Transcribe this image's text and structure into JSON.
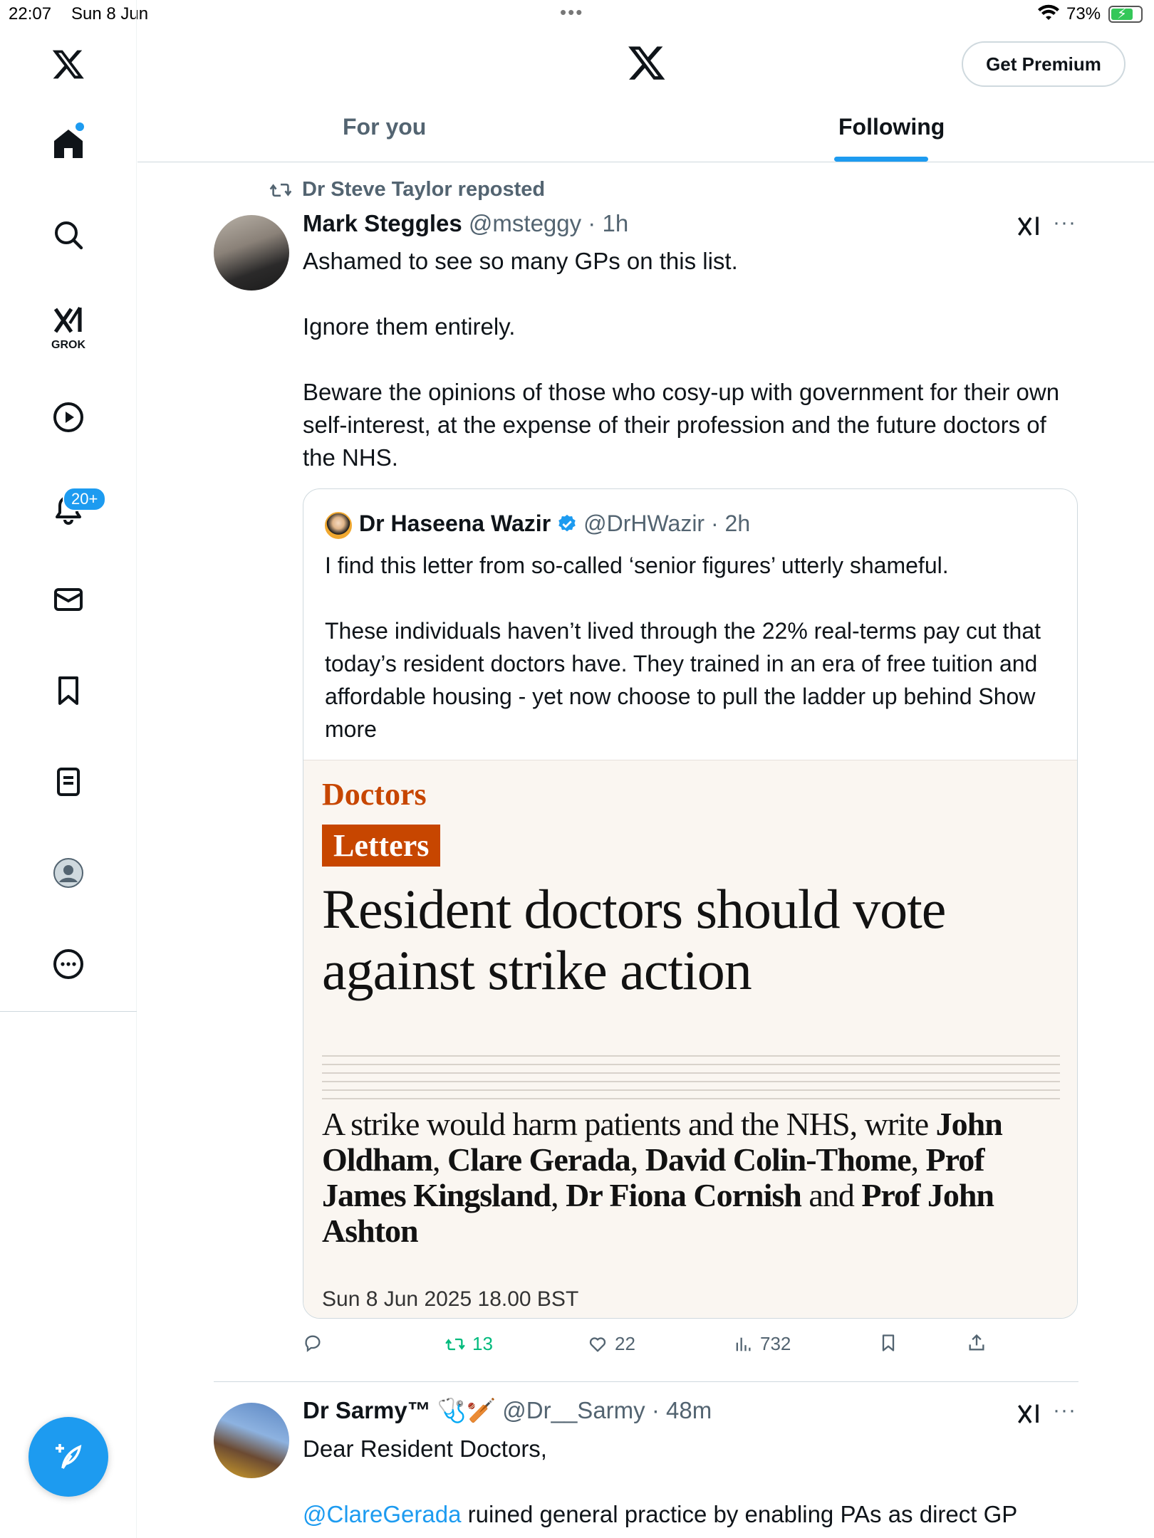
{
  "status_bar": {
    "time": "22:07",
    "date": "Sun 8 Jun",
    "battery": "73%"
  },
  "sidebar": {
    "items": [
      {
        "name": "home"
      },
      {
        "name": "explore"
      },
      {
        "name": "grok",
        "label": "GROK"
      },
      {
        "name": "video"
      },
      {
        "name": "notifications",
        "badge": "20+"
      },
      {
        "name": "messages"
      },
      {
        "name": "bookmarks"
      },
      {
        "name": "lists"
      },
      {
        "name": "profile"
      },
      {
        "name": "more"
      }
    ]
  },
  "header": {
    "premium_label": "Get Premium",
    "tabs": [
      {
        "label": "For you",
        "active": false
      },
      {
        "label": "Following",
        "active": true
      }
    ]
  },
  "tweets": [
    {
      "repost_by": "Dr Steve Taylor reposted",
      "name": "Mark Steggles",
      "handle": "@msteggy",
      "time": "1h",
      "text": [
        "Ashamed to see so many GPs on this list.",
        "",
        "Ignore them entirely.",
        "",
        "Beware the opinions of those who cosy-up with government for their own self-interest, at the expense of their profession and the future doctors of the NHS."
      ],
      "quote": {
        "name": "Dr Haseena Wazir",
        "handle": "@DrHWazir",
        "time": "2h",
        "text": [
          "I find this letter from so-called ‘senior figures’ utterly shameful.",
          "",
          "These individuals haven’t lived through the 22% real-terms pay cut that today’s resident doctors have. They trained in an era of free tuition and affordable housing - yet now choose to pull the ladder up behind"
        ],
        "show_more": "Show more",
        "article": {
          "section": "Doctors",
          "tag": "Letters",
          "title": "Resident doctors should vote against strike action",
          "standfirst_intro": "A strike would harm patients and the NHS, write",
          "authors": [
            "John Oldham",
            "Clare Gerada",
            "David Colin-Thome",
            "Prof James Kingsland",
            "Dr Fiona Cornish"
          ],
          "and_word": "and",
          "last_author": "Prof John Ashton",
          "date": "Sun 8 Jun 2025 18.00 BST"
        }
      },
      "stats": {
        "reposts": "13",
        "likes": "22",
        "views": "732"
      }
    },
    {
      "name": "Dr Sarmy™",
      "name_emoji": "🩺🏏",
      "handle": "@Dr__Sarmy",
      "time": "48m",
      "text_line1": "Dear Resident Doctors,",
      "mention": "@ClareGerada",
      "text_line2_rest": " ruined general practice by enabling PAs as direct GP"
    }
  ],
  "colors": {
    "accent": "#1d9bf0",
    "repost_green": "#00ba7c",
    "secondary_text": "#536471",
    "guardian_orange": "#c74600"
  }
}
